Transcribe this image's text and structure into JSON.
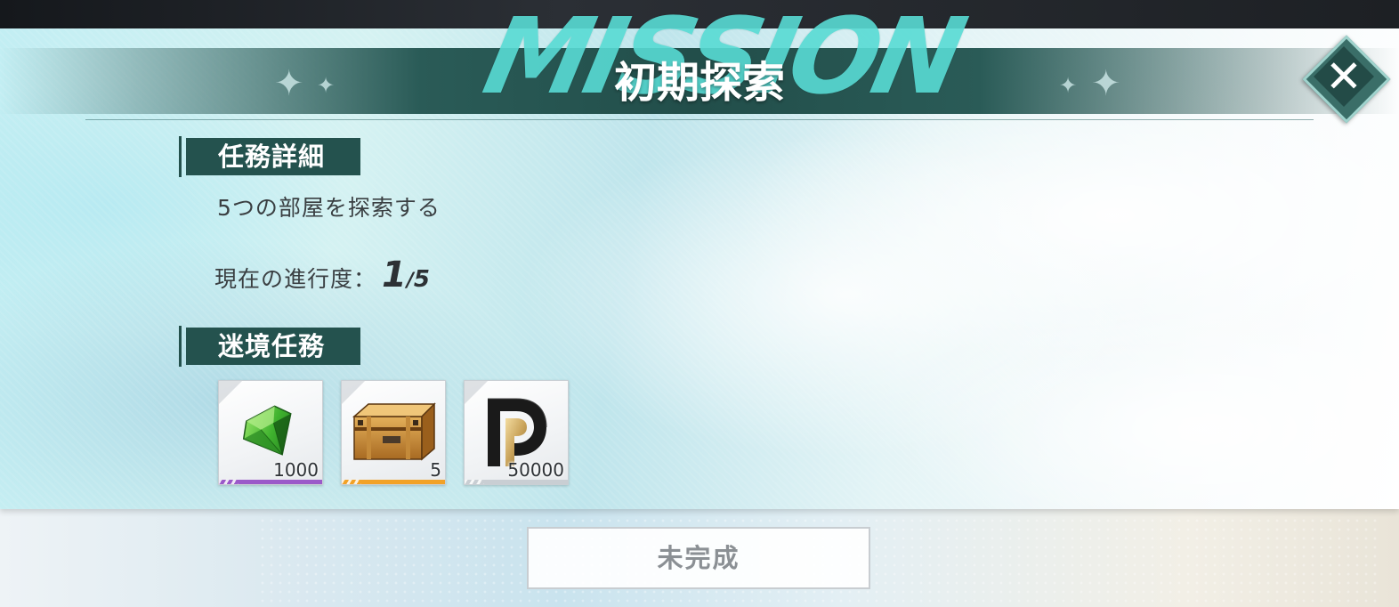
{
  "header": {
    "watermark": "MISSION",
    "title": "初期探索"
  },
  "task_details": {
    "heading": "任務詳細",
    "description": "5つの部屋を探索する",
    "progress_label": "現在の進行度：",
    "progress_current": "1",
    "progress_separator": "/",
    "progress_total": "5"
  },
  "rewards": {
    "heading": "迷境任務",
    "items": [
      {
        "icon": "green-gem-icon",
        "count": "1000",
        "rarity_color": "#9b59c9"
      },
      {
        "icon": "supply-crate-icon",
        "count": "5",
        "rarity_color": "#f2a227"
      },
      {
        "icon": "p-coin-icon",
        "count": "50000",
        "rarity_color": "#c9ced3"
      }
    ]
  },
  "actions": {
    "status_button": "未完成"
  },
  "colors": {
    "accent_dark": "#24524e",
    "watermark": "#58dbd4"
  }
}
